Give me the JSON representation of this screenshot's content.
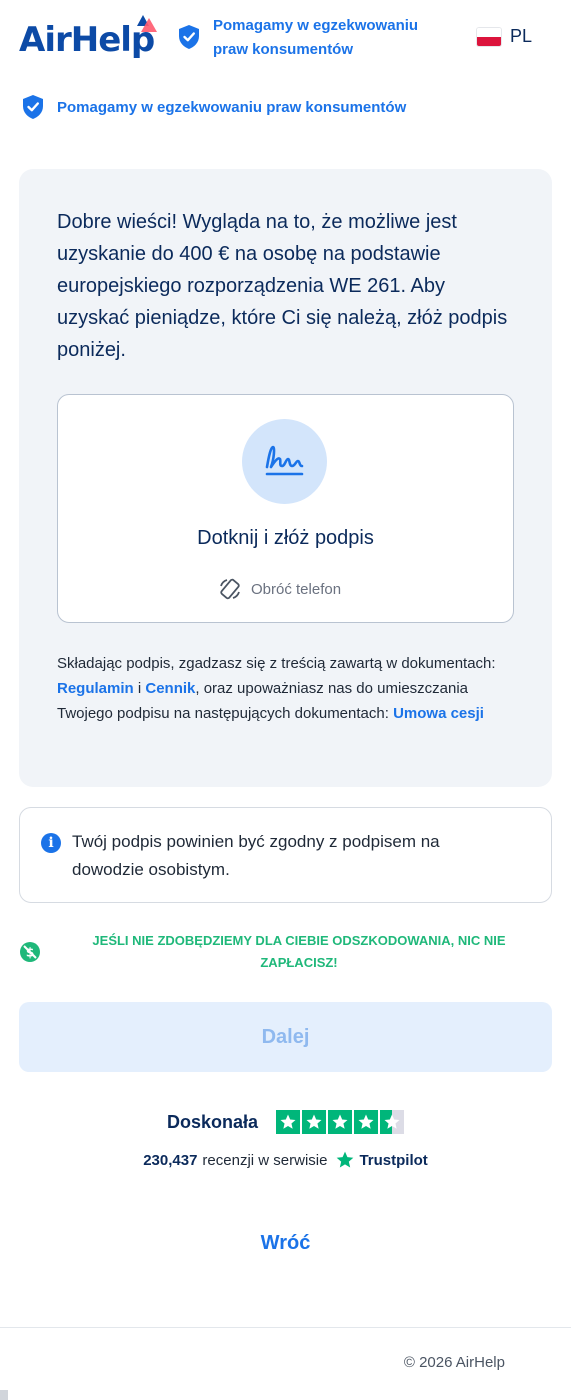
{
  "header": {
    "logo_text": "AirHelp",
    "badge_text": "Pomagamy w egzekwowaniu praw konsumentów",
    "language": "PL"
  },
  "sub_badge": {
    "text": "Pomagamy w egzekwowaniu praw konsumentów"
  },
  "card": {
    "title": "Dobre wieści! Wygląda na to, że możliwe jest uzyskanie do 400 € na osobę na podstawie europejskiego rozporządzenia WE 261. Aby uzyskać pieniądze, które Ci się należą, złóż podpis poniżej.",
    "sign_label": "Dotknij i złóż podpis",
    "rotate_label": "Obróć telefon",
    "consent": {
      "part1": "Składając podpis, zgadzasz się z treścią zawartą w dokumentach: ",
      "link_terms": "Regulamin",
      "and": " i ",
      "link_pricing": "Cennik",
      "part2": ", oraz upoważniasz nas do umieszczania Twojego podpisu na następujących dokumentach: ",
      "link_assignment": "Umowa cesji"
    }
  },
  "info": {
    "text": "Twój podpis powinien być zgodny z podpisem na dowodzie osobistym."
  },
  "guarantee": {
    "text": "JEŚLI NIE ZDOBĘDZIEMY DLA CIEBIE ODSZKODOWANIA, NIC NIE ZAPŁACISZ!"
  },
  "next_button": {
    "label": "Dalej"
  },
  "trustpilot": {
    "rating_label": "Doskonała",
    "stars": 4.5,
    "review_count": "230,437",
    "reviews_text": "recenzji w serwisie",
    "brand": "Trustpilot"
  },
  "back_link": {
    "label": "Wróć"
  },
  "footer": {
    "copyright": "© 2026 AirHelp"
  },
  "colors": {
    "brand_blue": "#1b73e8",
    "navy": "#0b2a5b",
    "green": "#1fb87a",
    "trustpilot_green": "#00b67a"
  }
}
